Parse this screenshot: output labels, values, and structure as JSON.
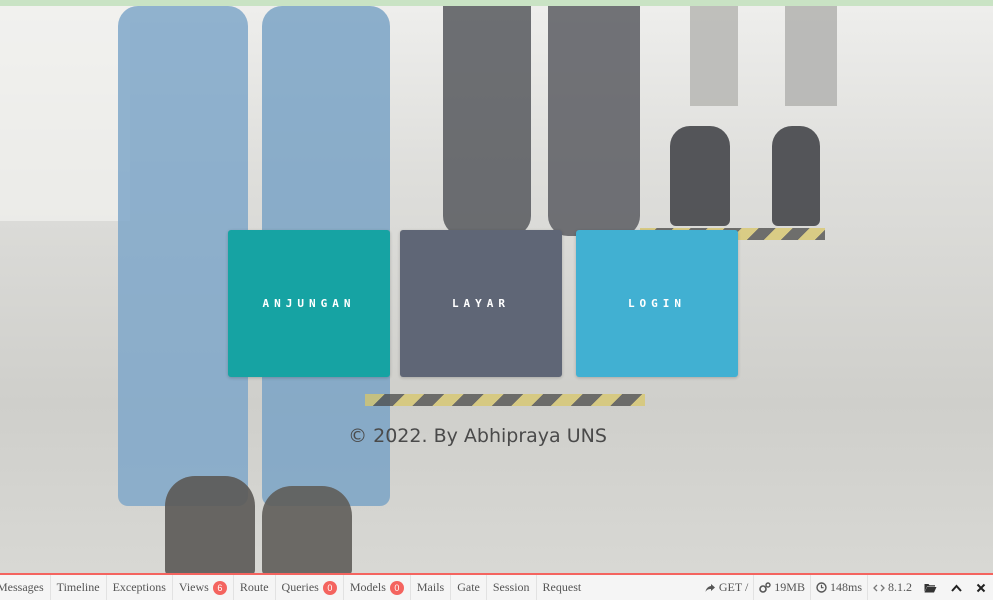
{
  "tiles": [
    {
      "label": "ANJUNGAN"
    },
    {
      "label": "LAYAR"
    },
    {
      "label": "LOGIN"
    }
  ],
  "footer": {
    "text": "© 2022. By Abhipraya UNS"
  },
  "debugbar": {
    "tabs": [
      {
        "label": "Messages"
      },
      {
        "label": "Timeline"
      },
      {
        "label": "Exceptions"
      },
      {
        "label": "Views",
        "badge": "6"
      },
      {
        "label": "Route"
      },
      {
        "label": "Queries",
        "badge": "0"
      },
      {
        "label": "Models",
        "badge": "0"
      },
      {
        "label": "Mails"
      },
      {
        "label": "Gate"
      },
      {
        "label": "Session"
      },
      {
        "label": "Request"
      }
    ],
    "request_method": "GET /",
    "memory": "19MB",
    "duration": "148ms",
    "php_version": "8.1.2"
  },
  "colors": {
    "anjungan": "#16a3a3",
    "layar": "#5f6676",
    "login": "#41b0d2",
    "debug_accent": "#f4645f"
  }
}
